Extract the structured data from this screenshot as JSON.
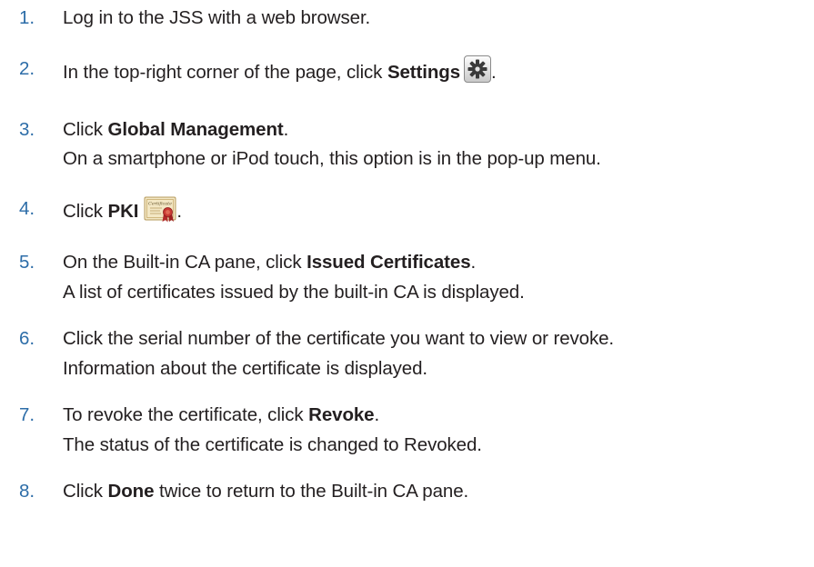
{
  "steps": [
    {
      "number": "1.",
      "lines": [
        {
          "text": "Log in to the JSS with a web browser."
        }
      ]
    },
    {
      "number": "2.",
      "lines": [
        {
          "pre": "In the top-right corner of the page, click ",
          "bold": "Settings",
          "post": ".",
          "icon": "gear-icon"
        }
      ]
    },
    {
      "number": "3.",
      "lines": [
        {
          "pre": "Click ",
          "bold": "Global Management",
          "post": "."
        },
        {
          "text": "On a smartphone or iPod touch, this option is in the pop-up menu."
        }
      ]
    },
    {
      "number": "4.",
      "lines": [
        {
          "pre": "Click ",
          "bold": "PKI",
          "post": ".",
          "icon": "certificate-icon"
        }
      ]
    },
    {
      "number": "5.",
      "lines": [
        {
          "pre": "On the Built-in CA pane, click ",
          "bold": "Issued Certificates",
          "post": "."
        },
        {
          "text": "A list of certificates issued by the built-in CA is displayed."
        }
      ]
    },
    {
      "number": "6.",
      "lines": [
        {
          "text": "Click the serial number of the certificate you want to view or revoke."
        },
        {
          "text": "Information about the certificate is displayed."
        }
      ]
    },
    {
      "number": "7.",
      "lines": [
        {
          "pre": "To revoke the certificate, click ",
          "bold": "Revoke",
          "post": "."
        },
        {
          "text": "The status of the certificate is changed to Revoked."
        }
      ]
    },
    {
      "number": "8.",
      "lines": [
        {
          "pre": "Click ",
          "bold": "Done",
          "post": " twice to return to the Built-in CA pane."
        }
      ]
    }
  ],
  "icons": {
    "certificate_label": "Certificate"
  },
  "colors": {
    "number": "#2d6da8",
    "text": "#231f20"
  }
}
